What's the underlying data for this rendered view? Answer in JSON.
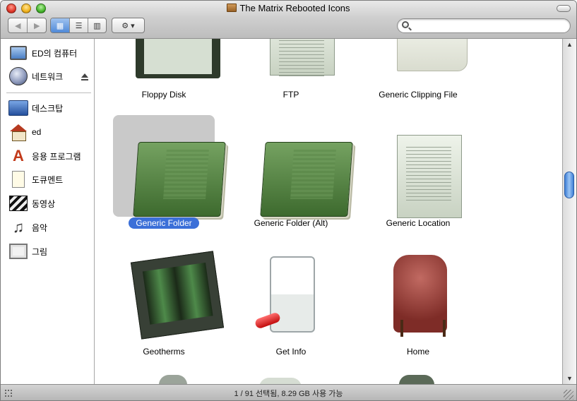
{
  "window": {
    "title": "The Matrix Rebooted Icons"
  },
  "toolbar": {
    "back_icon": "back-arrow",
    "forward_icon": "forward-arrow",
    "view_icons": [
      "icon-view",
      "list-view",
      "column-view"
    ],
    "action_icon": "gear-icon",
    "search": {
      "value": "",
      "placeholder": ""
    }
  },
  "sidebar": {
    "devices": [
      {
        "label": "ED의 컴퓨터",
        "icon": "computer-icon"
      },
      {
        "label": "네트워크",
        "icon": "network-icon",
        "ejectable": true
      }
    ],
    "places": [
      {
        "label": "데스크탑",
        "icon": "desktop-icon"
      },
      {
        "label": "ed",
        "icon": "home-icon"
      },
      {
        "label": "응용 프로그램",
        "icon": "applications-icon"
      },
      {
        "label": "도큐멘트",
        "icon": "documents-icon"
      },
      {
        "label": "동영상",
        "icon": "movies-icon"
      },
      {
        "label": "음악",
        "icon": "music-icon"
      },
      {
        "label": "그림",
        "icon": "pictures-icon"
      }
    ]
  },
  "content": {
    "items": [
      {
        "label": "Floppy Disk",
        "icon": "floppy-disk-icon"
      },
      {
        "label": "FTP",
        "icon": "ftp-icon"
      },
      {
        "label": "Generic Clipping File",
        "icon": "clipping-file-icon"
      },
      {
        "label": "Generic Folder",
        "icon": "generic-folder-icon",
        "selected": true
      },
      {
        "label": "Generic Folder (Alt)",
        "icon": "generic-folder-alt-icon"
      },
      {
        "label": "Generic Location",
        "icon": "generic-location-icon"
      },
      {
        "label": "Geotherms",
        "icon": "geotherms-icon"
      },
      {
        "label": "Get Info",
        "icon": "get-info-icon"
      },
      {
        "label": "Home",
        "icon": "home-chair-icon"
      }
    ],
    "selection_color": "#3b6fd8"
  },
  "status": {
    "text": "1 / 91 선택됨, 8.29 GB 사용 가능"
  }
}
